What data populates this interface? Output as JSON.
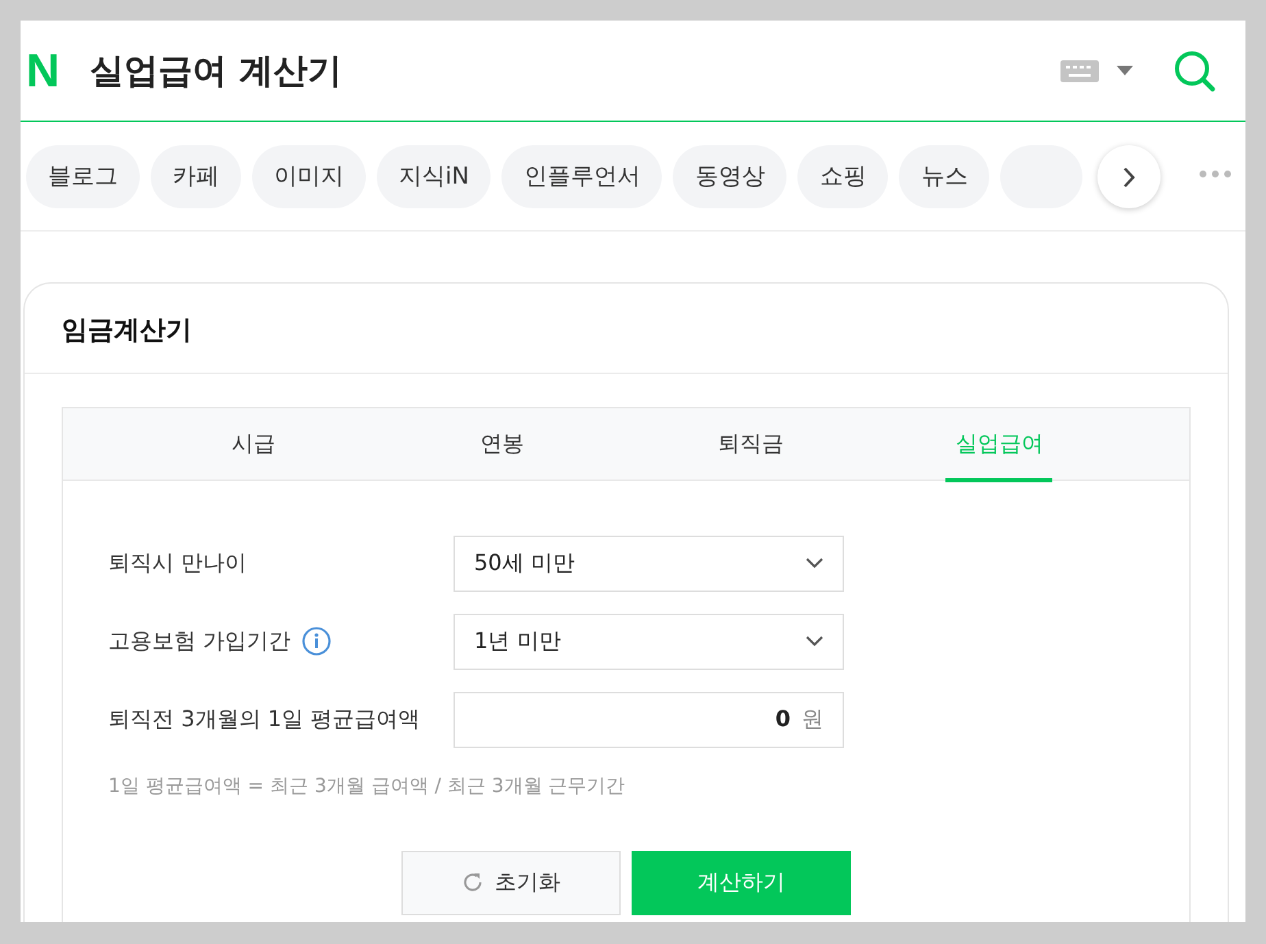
{
  "header": {
    "logo": "N",
    "title": "실업급여 계산기"
  },
  "categories": [
    {
      "label": "블로그"
    },
    {
      "label": "카페"
    },
    {
      "label": "이미지"
    },
    {
      "label": "지식iN"
    },
    {
      "label": "인플루언서"
    },
    {
      "label": "동영상"
    },
    {
      "label": "쇼핑"
    },
    {
      "label": "뉴스"
    }
  ],
  "calculator": {
    "title": "임금계산기",
    "tabs": [
      {
        "label": "시급",
        "selected": false
      },
      {
        "label": "연봉",
        "selected": false
      },
      {
        "label": "퇴직금",
        "selected": false
      },
      {
        "label": "실업급여",
        "selected": true
      }
    ],
    "fields": [
      {
        "kind": "select",
        "label": "퇴직시 만나이",
        "value": "50세 미만"
      },
      {
        "kind": "select",
        "label": "고용보험 가입기간",
        "info": true,
        "value": "1년 미만"
      },
      {
        "kind": "amount",
        "label": "퇴직전 3개월의 1일 평균급여액",
        "value": "0",
        "unit": "원"
      }
    ],
    "hint": "1일 평균급여액 = 최근 3개월 급여액 / 최근 3개월 근무기간",
    "buttons": [
      {
        "kind": "reset",
        "label": "초기화"
      },
      {
        "kind": "primary",
        "label": "계산하기"
      }
    ]
  }
}
